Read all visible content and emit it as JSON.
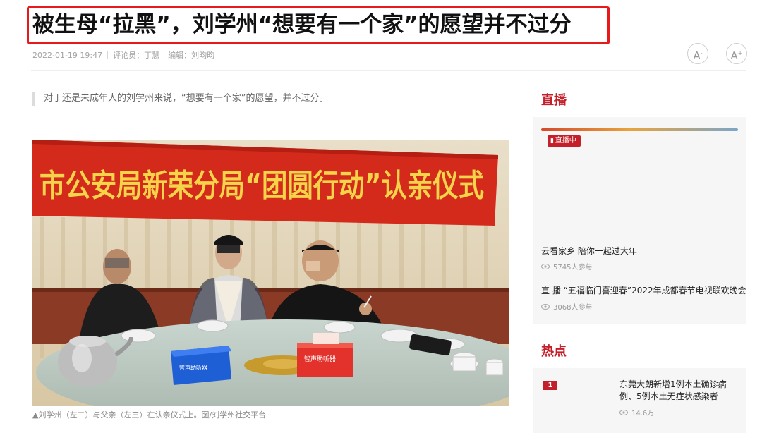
{
  "article": {
    "headline": "被生母“拉黑”，刘学州“想要有一个家”的愿望并不过分",
    "date": "2022-01-19 19:47",
    "commentator": "评论员：丁慧",
    "editor": "编辑：刘昀昀",
    "font_small_label": "A",
    "font_small_mark": "-",
    "font_large_label": "A",
    "font_large_mark": "+",
    "summary": "对于还是未成年人的刘学州来说，“想要有一个家”的愿望，并不过分。",
    "photo_banner": "市公安局新荣分局“团圆行动”认亲仪式",
    "photo_box_left": "智声助听器",
    "photo_box_right": "智声助听器",
    "caption": "▲刘学州（左二）与父亲（左三）在认亲仪式上。图/刘学州社交平台"
  },
  "sidebar": {
    "live_title": "直播",
    "live_tag": "直播中",
    "live_items": [
      {
        "title": "云看家乡 陪你一起过大年",
        "views": "5745人参与"
      },
      {
        "title": "直 播 “五福临门喜迎春”2022年成都春节电视联欢晚会",
        "views": "3068人参与"
      }
    ],
    "hot_title": "热点",
    "hot_items": [
      {
        "rank": "1",
        "title": "东莞大朗新增1例本土确诊病例、5例本土无症状感染者",
        "views": "14.6万"
      }
    ]
  },
  "colors": {
    "accent": "#c4202a",
    "headline_border": "#e8191b",
    "meta_text": "#a3a3a3"
  }
}
